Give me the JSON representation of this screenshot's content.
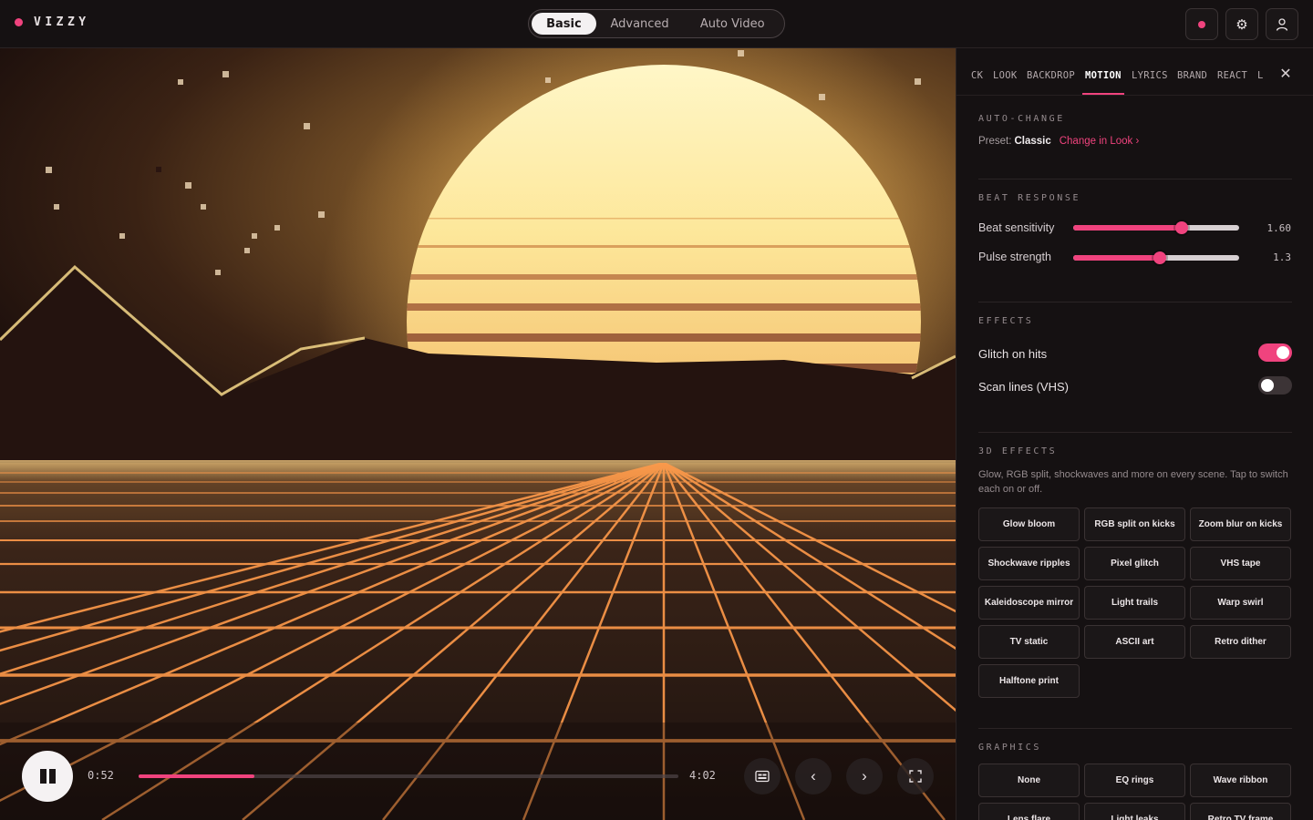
{
  "brand": {
    "name": "VIZZY",
    "accent": "#f0437e"
  },
  "modes": [
    {
      "label": "Basic",
      "active": true
    },
    {
      "label": "Advanced",
      "active": false
    },
    {
      "label": "Auto Video",
      "active": false
    }
  ],
  "top_actions": {
    "record_icon": "record-dot-icon",
    "settings_icon": "gear-icon",
    "account_icon": "user-icon"
  },
  "player": {
    "current_time": "0:52",
    "total_time": "4:02",
    "progress": 0.215,
    "icons": [
      "pause-icon",
      "captions-icon",
      "chevron-left-icon",
      "chevron-right-icon",
      "fullscreen-icon"
    ]
  },
  "panel": {
    "tabs": [
      "CK",
      "LOOK",
      "BACKDROP",
      "MOTION",
      "LYRICS",
      "BRAND",
      "REACT",
      "L"
    ],
    "active_tab": "MOTION",
    "auto_change": {
      "title": "AUTO-CHANGE",
      "preset_label": "Preset:",
      "preset_value": "Classic",
      "link": "Change in Look ›"
    },
    "beat_response": {
      "title": "BEAT RESPONSE",
      "sliders": [
        {
          "label": "Beat sensitivity",
          "value": "1.60",
          "fraction": 0.655
        },
        {
          "label": "Pulse strength",
          "value": "1.3",
          "fraction": 0.52
        }
      ]
    },
    "effects": {
      "title": "EFFECTS",
      "toggles": [
        {
          "label": "Glitch on hits",
          "on": true
        },
        {
          "label": "Scan lines (VHS)",
          "on": false
        }
      ]
    },
    "effects_3d": {
      "title": "3D EFFECTS",
      "description": "Glow, RGB split, shockwaves and more on every scene. Tap to switch each on or off.",
      "buttons": [
        "Glow bloom",
        "RGB split on kicks",
        "Zoom blur on kicks",
        "Shockwave ripples",
        "Pixel glitch",
        "VHS tape",
        "Kaleidoscope mirror",
        "Light trails",
        "Warp swirl",
        "TV static",
        "ASCII art",
        "Retro dither",
        "Halftone print"
      ]
    },
    "graphics": {
      "title": "GRAPHICS",
      "buttons": [
        "None",
        "EQ rings",
        "Wave ribbon",
        "Lens flare",
        "Light leaks",
        "Retro TV frame"
      ]
    }
  }
}
